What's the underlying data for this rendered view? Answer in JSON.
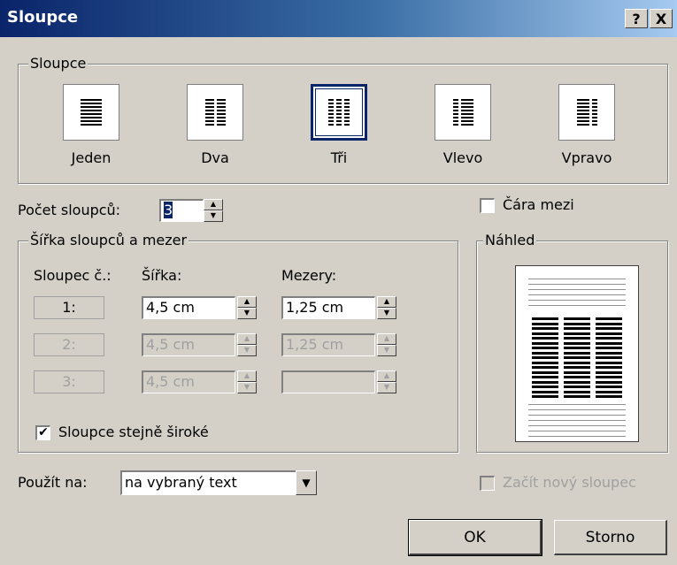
{
  "window": {
    "title": "Sloupce",
    "help_button": "?",
    "close_button": "X"
  },
  "presets_group": {
    "legend": "Sloupce",
    "items": [
      {
        "label": "Jeden",
        "columns": 1,
        "selected": false
      },
      {
        "label": "Dva",
        "columns": 2,
        "selected": false
      },
      {
        "label": "Tři",
        "columns": 3,
        "selected": true
      },
      {
        "label": "Vlevo",
        "columns": 2,
        "selected": false
      },
      {
        "label": "Vpravo",
        "columns": 2,
        "selected": false
      }
    ]
  },
  "column_count": {
    "label": "Počet sloupců:",
    "value": "3"
  },
  "line_between": {
    "label": "Čára mezi",
    "checked": false
  },
  "width_group": {
    "legend": "Šířka sloupců a mezer",
    "headers": {
      "column": "Sloupec č.:",
      "width": "Šířka:",
      "spacing": "Mezery:"
    },
    "rows": [
      {
        "number": "1:",
        "width": "4,5 cm",
        "spacing": "1,25 cm",
        "enabled": true
      },
      {
        "number": "2:",
        "width": "4,5 cm",
        "spacing": "1,25 cm",
        "enabled": false
      },
      {
        "number": "3:",
        "width": "4,5 cm",
        "spacing": "",
        "enabled": false
      }
    ],
    "equal_width": {
      "label": "Sloupce stejně široké",
      "checked": true
    }
  },
  "preview": {
    "legend": "Náhled",
    "columns": 3
  },
  "apply_to": {
    "label": "Použít na:",
    "value": "na vybraný text"
  },
  "start_new_column": {
    "label": "Začít nový sloupec",
    "checked": false,
    "enabled": false
  },
  "buttons": {
    "ok": "OK",
    "cancel": "Storno"
  }
}
